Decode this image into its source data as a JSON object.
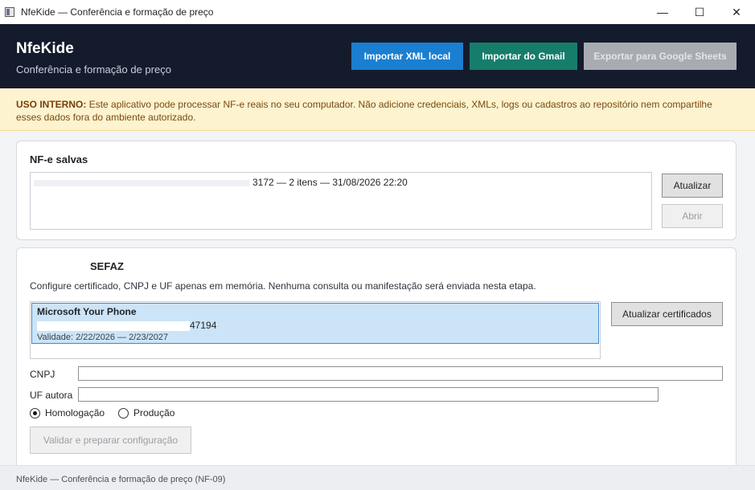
{
  "window": {
    "title": "NfeKide — Conferência e formação de preço",
    "minimize": "—",
    "maximize": "☐",
    "close": "✕"
  },
  "header": {
    "app_name": "NfeKide",
    "subtitle": "Conferência e formação de preço",
    "buttons": {
      "import_xml": "Importar XML local",
      "import_gmail": "Importar do Gmail",
      "export_sheets": "Exportar para Google Sheets"
    }
  },
  "warning": {
    "label": "USO INTERNO:",
    "text": "Este aplicativo pode processar NF-e reais no seu computador. Não adicione credenciais, XMLs, logs ou cadastros ao repositório nem compartilhe esses dados fora do ambiente autorizado."
  },
  "saved_nfe": {
    "title": "NF-e salvas",
    "items": [
      {
        "text": "3172 — 2 itens — 31/08/2026 22:20"
      }
    ],
    "refresh_button": "Atualizar",
    "open_button": "Abrir"
  },
  "sefaz": {
    "title": "SEFAZ",
    "description": "Configure certificado, CNPJ e UF apenas em memória. Nenhuma consulta ou manifestação será enviada nesta etapa.",
    "certificates": [
      {
        "name": "Microsoft Your Phone",
        "serial_suffix": "47194",
        "validity": "Validade: 2/22/2026 — 2/23/2027"
      }
    ],
    "refresh_certificates_button": "Atualizar certificados",
    "cnpj_label": "CNPJ",
    "cnpj_value": "",
    "uf_label": "UF autora",
    "uf_value": "",
    "environment_options": [
      "Homologação",
      "Produção"
    ],
    "environment_selected": "Homologação",
    "validate_button": "Validar e preparar configuração"
  },
  "status_bar": {
    "text": "NfeKide — Conferência e formação de preço (NF-09)"
  }
}
